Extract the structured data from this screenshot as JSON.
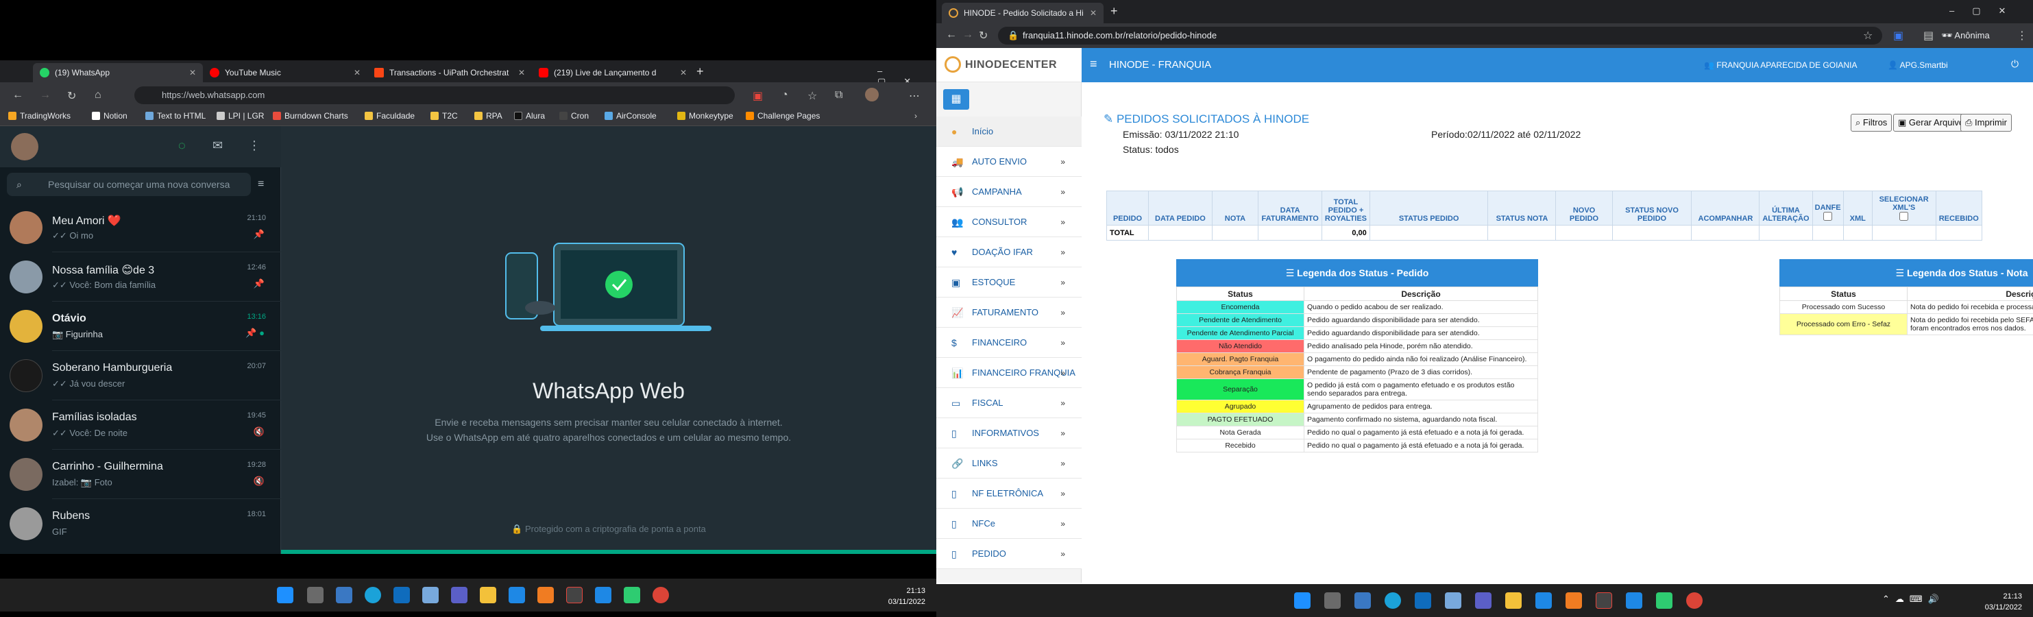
{
  "left": {
    "tabs": [
      {
        "label": "(19) WhatsApp",
        "color": "#25d366"
      },
      {
        "label": "YouTube Music",
        "color": "#ff0000"
      },
      {
        "label": "Transactions - UiPath Orchestrat",
        "color": "#fa4616"
      },
      {
        "label": "(219) Live de Lançamento d",
        "color": "#ff0000"
      }
    ],
    "url": "https://web.whatsapp.com",
    "bookmarks": [
      {
        "label": "TradingWorks",
        "color": "#f5a623"
      },
      {
        "label": "Notion",
        "color": "#ffffff"
      },
      {
        "label": "Text to HTML",
        "color": "#6fa8dc"
      },
      {
        "label": "LPI | LGR",
        "color": "#cccccc"
      },
      {
        "label": "Burndown Charts",
        "color": "#e84c3d"
      },
      {
        "label": "Faculdade",
        "color": "#f4c542"
      },
      {
        "label": "T2C",
        "color": "#f4c542"
      },
      {
        "label": "RPA",
        "color": "#f4c542"
      },
      {
        "label": "Alura",
        "color": "#111111"
      },
      {
        "label": "Cron",
        "color": "#444444"
      },
      {
        "label": "AirConsole",
        "color": "#5aa9e6"
      },
      {
        "label": "Monkeytype",
        "color": "#e2b714"
      },
      {
        "label": "Challenge Pages",
        "color": "#ff8c00"
      }
    ],
    "whatsapp": {
      "search_placeholder": "Pesquisar ou começar uma nova conversa",
      "chats": [
        {
          "name": "Meu Amori ❤️",
          "msg": "✓✓ Oi mo",
          "time": "21:10",
          "pinned": "📌",
          "avatar": "#b07a5a"
        },
        {
          "name": "Nossa família 😊de 3",
          "msg": "✓✓ Você: Bom dia família",
          "time": "12:46",
          "pinned": "📌",
          "avatar": "#8a9aa8"
        },
        {
          "name": "Otávio",
          "msg": "📷 Figurinha",
          "time": "13:16",
          "pinned": "📌 ●",
          "avatar": "#e3b33c"
        },
        {
          "name": "Soberano Hamburgueria",
          "msg": "✓✓ Já vou descer",
          "time": "20:07",
          "pinned": "",
          "avatar": "#1a1a1a"
        },
        {
          "name": "Famílias isoladas",
          "msg": "✓✓ Você: De noite",
          "time": "19:45",
          "pinned": "🔇",
          "avatar": "#b0876a"
        },
        {
          "name": "Carrinho - Guilhermina",
          "msg": "Izabel: 📷 Foto",
          "time": "19:28",
          "pinned": "🔇",
          "avatar": "#7a6a60"
        },
        {
          "name": "Rubens",
          "msg": "GIF",
          "time": "18:01",
          "pinned": "",
          "avatar": "#9a9a9a"
        }
      ],
      "title": "WhatsApp Web",
      "sub1": "Envie e receba mensagens sem precisar manter seu celular conectado à internet.",
      "sub2": "Use o WhatsApp em até quatro aparelhos conectados e um celular ao mesmo tempo.",
      "encrypted": "🔒 Protegido com a criptografia de ponta a ponta"
    },
    "clock": {
      "time": "21:13",
      "date": "03/11/2022"
    }
  },
  "right": {
    "tab": "HINODE - Pedido Solicitado a Hi",
    "url": "franquia11.hinode.com.br/relatorio/pedido-hinode",
    "profile": "Anônima",
    "logo": "HINODECENTER",
    "brand": "HINODE - FRANQUIA",
    "franchise": "FRANQUIA APARECIDA DE GOIANIA",
    "user": "APG.Smartbi",
    "menu": [
      {
        "label": "Início",
        "arrow": ""
      },
      {
        "label": "AUTO ENVIO",
        "arrow": "»"
      },
      {
        "label": "CAMPANHA",
        "arrow": "»"
      },
      {
        "label": "CONSULTOR",
        "arrow": "»"
      },
      {
        "label": "DOAÇÃO IFAR",
        "arrow": "»"
      },
      {
        "label": "ESTOQUE",
        "arrow": "»"
      },
      {
        "label": "FATURAMENTO",
        "arrow": "»"
      },
      {
        "label": "FINANCEIRO",
        "arrow": "»"
      },
      {
        "label": "FINANCEIRO FRANQUIA",
        "arrow": "»"
      },
      {
        "label": "FISCAL",
        "arrow": "»"
      },
      {
        "label": "INFORMATIVOS",
        "arrow": "»"
      },
      {
        "label": "LINKS",
        "arrow": "»"
      },
      {
        "label": "NF ELETRÔNICA",
        "arrow": "»"
      },
      {
        "label": "NFCe",
        "arrow": "»"
      },
      {
        "label": "PEDIDO",
        "arrow": "»"
      }
    ],
    "report": {
      "title": "PEDIDOS SOLICITADOS À HINODE",
      "emissao": "Emissão: 03/11/2022 21:10",
      "status": "Status: todos",
      "periodo": "Período:02/11/2022 até 02/11/2022",
      "btn_filtros": "Filtros",
      "btn_gerar": "Gerar Arquivo",
      "btn_imprimir": "Imprimir"
    },
    "table": {
      "headers": [
        "PEDIDO",
        "DATA PEDIDO",
        "NOTA",
        "DATA FATURAMENTO",
        "TOTAL PEDIDO + ROYALTIES",
        "STATUS PEDIDO",
        "STATUS NOTA",
        "NOVO PEDIDO",
        "STATUS NOVO PEDIDO",
        "ACOMPANHAR",
        "ÚLTIMA ALTERAÇÃO",
        "DANFE",
        "XML",
        "SELECIONAR XML'S",
        "RECEBIDO"
      ],
      "total_label": "TOTAL",
      "total_value": "0,00"
    },
    "legend_pedido": {
      "title": "Legenda dos Status - Pedido",
      "col1": "Status",
      "col2": "Descrição",
      "rows": [
        {
          "s": "Encomenda",
          "d": "Quando o pedido acabou de ser realizado.",
          "c": "#3ff0e0"
        },
        {
          "s": "Pendente de Atendimento",
          "d": "Pedido aguardando disponibilidade para ser atendido.",
          "c": "#3ff0e0"
        },
        {
          "s": "Pendente de Atendimento Parcial",
          "d": "Pedido aguardando disponibilidade para ser atendido.",
          "c": "#3ff0e0"
        },
        {
          "s": "Não Atendido",
          "d": "Pedido analisado pela Hinode, porém não atendido.",
          "c": "#ff6b6b"
        },
        {
          "s": "Aguard. Pagto Franquia",
          "d": "O pagamento do pedido ainda não foi realizado (Análise Financeiro).",
          "c": "#ffb570"
        },
        {
          "s": "Cobrança Franquia",
          "d": "Pendente de pagamento (Prazo de 3 dias corridos).",
          "c": "#ffb570"
        },
        {
          "s": "Separação",
          "d": "O pedido já está com o pagamento efetuado e os produtos estão sendo separados para entrega.",
          "c": "#19e85a"
        },
        {
          "s": "Agrupado",
          "d": "Agrupamento de pedidos para entrega.",
          "c": "#ffff33"
        },
        {
          "s": "PAGTO EFETUADO",
          "d": "Pagamento confirmado no sistema, aguardando nota fiscal.",
          "c": "#c6f5c6"
        },
        {
          "s": "Nota Gerada",
          "d": "Pedido no qual o pagamento já está efetuado e a nota já foi gerada.",
          "c": "#ffffff"
        },
        {
          "s": "Recebido",
          "d": "Pedido no qual o pagamento já está efetuado e a nota já foi gerada.",
          "c": "#ffffff"
        }
      ]
    },
    "legend_nota": {
      "title": "Legenda dos Status - Nota",
      "col1": "Status",
      "col2": "Descrição",
      "rows": [
        {
          "s": "Processado com Sucesso",
          "d": "Nota do pedido foi recebida e processada com Sucesso pelo SEFAZ.",
          "c": "#ffffff"
        },
        {
          "s": "Processado com Erro - Sefaz",
          "d": "Nota do pedido foi recebida pelo SEFAZ, porém no processamento foram encontrados erros nos dados.",
          "c": "#ffff99"
        }
      ]
    },
    "clock": {
      "time": "21:13",
      "date": "03/11/2022"
    }
  }
}
